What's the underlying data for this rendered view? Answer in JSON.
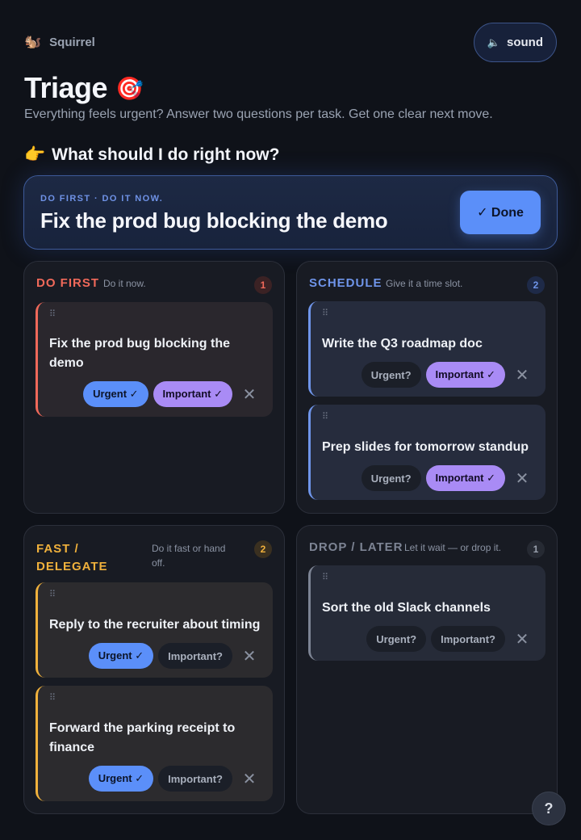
{
  "brand": {
    "icon": "🐿️",
    "name": "Squirrel"
  },
  "sound": {
    "icon": "🔈",
    "label": "sound"
  },
  "header": {
    "title": "Triage",
    "title_emoji": "🎯",
    "subtitle": "Everything feels urgent? Answer two questions per task. Get one clear next move."
  },
  "next_move": {
    "pointer_emoji": "👉",
    "question": "What should I do right now?",
    "eyebrow": "DO FIRST · DO IT NOW.",
    "task": "Fix the prod bug blocking the demo",
    "done_label": "✓ Done"
  },
  "colors": {
    "do_first": "#f0695a",
    "schedule": "#6f95ea",
    "delegate": "#f0b13c",
    "drop": "#7d8494"
  },
  "quadrants": {
    "do_first": {
      "title": "DO FIRST",
      "hint": "Do it now.",
      "count": "1",
      "tasks": [
        {
          "text": "Fix the prod bug blocking the demo",
          "urgent": "Urgent ✓",
          "important": "Important ✓"
        }
      ]
    },
    "schedule": {
      "title": "SCHEDULE",
      "hint": "Give it a time slot.",
      "count": "2",
      "tasks": [
        {
          "text": "Write the Q3 roadmap doc",
          "urgent": "Urgent?",
          "important": "Important ✓"
        },
        {
          "text": "Prep slides for tomorrow standup",
          "urgent": "Urgent?",
          "important": "Important ✓"
        }
      ]
    },
    "delegate": {
      "title_line1": "FAST /",
      "title_line2": "DELEGATE",
      "hint_line1": "Do it fast or hand",
      "hint_line2": "off.",
      "count": "2",
      "tasks": [
        {
          "text": "Reply to the recruiter about timing",
          "urgent": "Urgent ✓",
          "important": "Important?"
        },
        {
          "text": "Forward the parking receipt to finance",
          "urgent": "Urgent ✓",
          "important": "Important?"
        }
      ]
    },
    "drop": {
      "title": "DROP / LATER",
      "hint": "Let it wait — or drop it.",
      "count": "1",
      "tasks": [
        {
          "text": "Sort the old Slack channels",
          "urgent": "Urgent?",
          "important": "Important?"
        }
      ]
    }
  },
  "remove_glyph": "✕",
  "drag_glyph": "⠿",
  "help_label": "?"
}
